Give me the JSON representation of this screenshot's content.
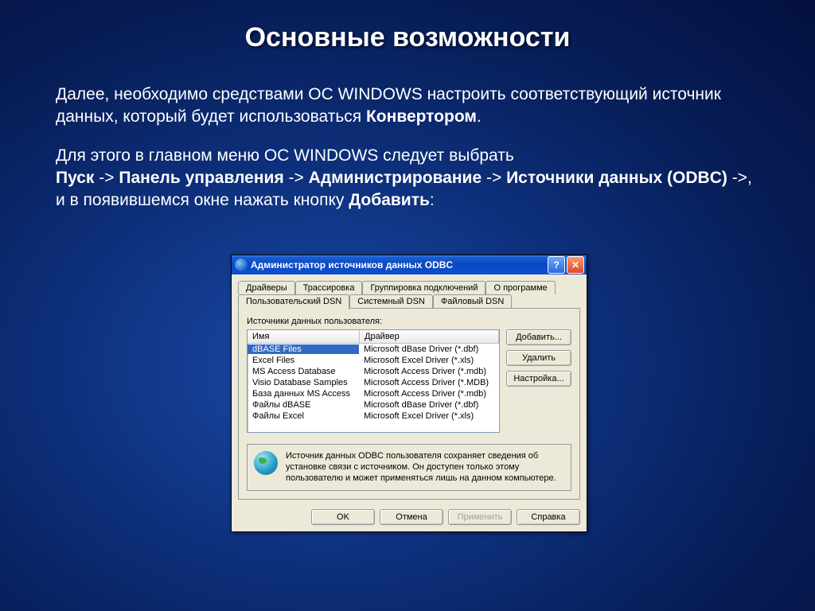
{
  "slide": {
    "title": "Основные возможности",
    "p1a": "Далее, необходимо средствами ОС WINDOWS настроить соответствующий источник данных, который будет использоваться ",
    "p1b": "Конвертором",
    "p1c": ".",
    "p2a": "Для этого в главном меню ОС WINDOWS следует выбрать",
    "p2_path": [
      "Пуск",
      "Панель управления",
      "Администрирование",
      "Источники данных (ODBC)"
    ],
    "p2_tail": ", и в появившемся окне нажать кнопку ",
    "p2_btn": "Добавить",
    "p2_colon": ":"
  },
  "dialog": {
    "title": "Администратор источников данных ODBC",
    "tabs_top": [
      "Драйверы",
      "Трассировка",
      "Группировка подключений",
      "О программе"
    ],
    "tabs_bottom": [
      "Пользовательский DSN",
      "Системный DSN",
      "Файловый DSN"
    ],
    "active_tab": "Пользовательский DSN",
    "list_label": "Источники данных пользователя:",
    "columns": {
      "name": "Имя",
      "driver": "Драйвер"
    },
    "rows": [
      {
        "name": "dBASE Files",
        "driver": "Microsoft dBase Driver (*.dbf)",
        "selected": true
      },
      {
        "name": "Excel Files",
        "driver": "Microsoft Excel Driver (*.xls)"
      },
      {
        "name": "MS Access Database",
        "driver": "Microsoft Access Driver (*.mdb)"
      },
      {
        "name": "Visio Database Samples",
        "driver": "Microsoft Access Driver (*.MDB)"
      },
      {
        "name": "База данных MS Access",
        "driver": "Microsoft Access Driver (*.mdb)"
      },
      {
        "name": "Файлы dBASE",
        "driver": "Microsoft dBase Driver (*.dbf)"
      },
      {
        "name": "Файлы Excel",
        "driver": "Microsoft Excel Driver (*.xls)"
      }
    ],
    "buttons": {
      "add": "Добавить...",
      "remove": "Удалить",
      "configure": "Настройка...",
      "ok": "OK",
      "cancel": "Отмена",
      "apply": "Применить",
      "help": "Справка"
    },
    "info": "Источник данных ODBC пользователя сохраняет сведения об установке связи с источником.  Он доступен только этому пользователю и может применяться лишь на данном компьютере."
  }
}
